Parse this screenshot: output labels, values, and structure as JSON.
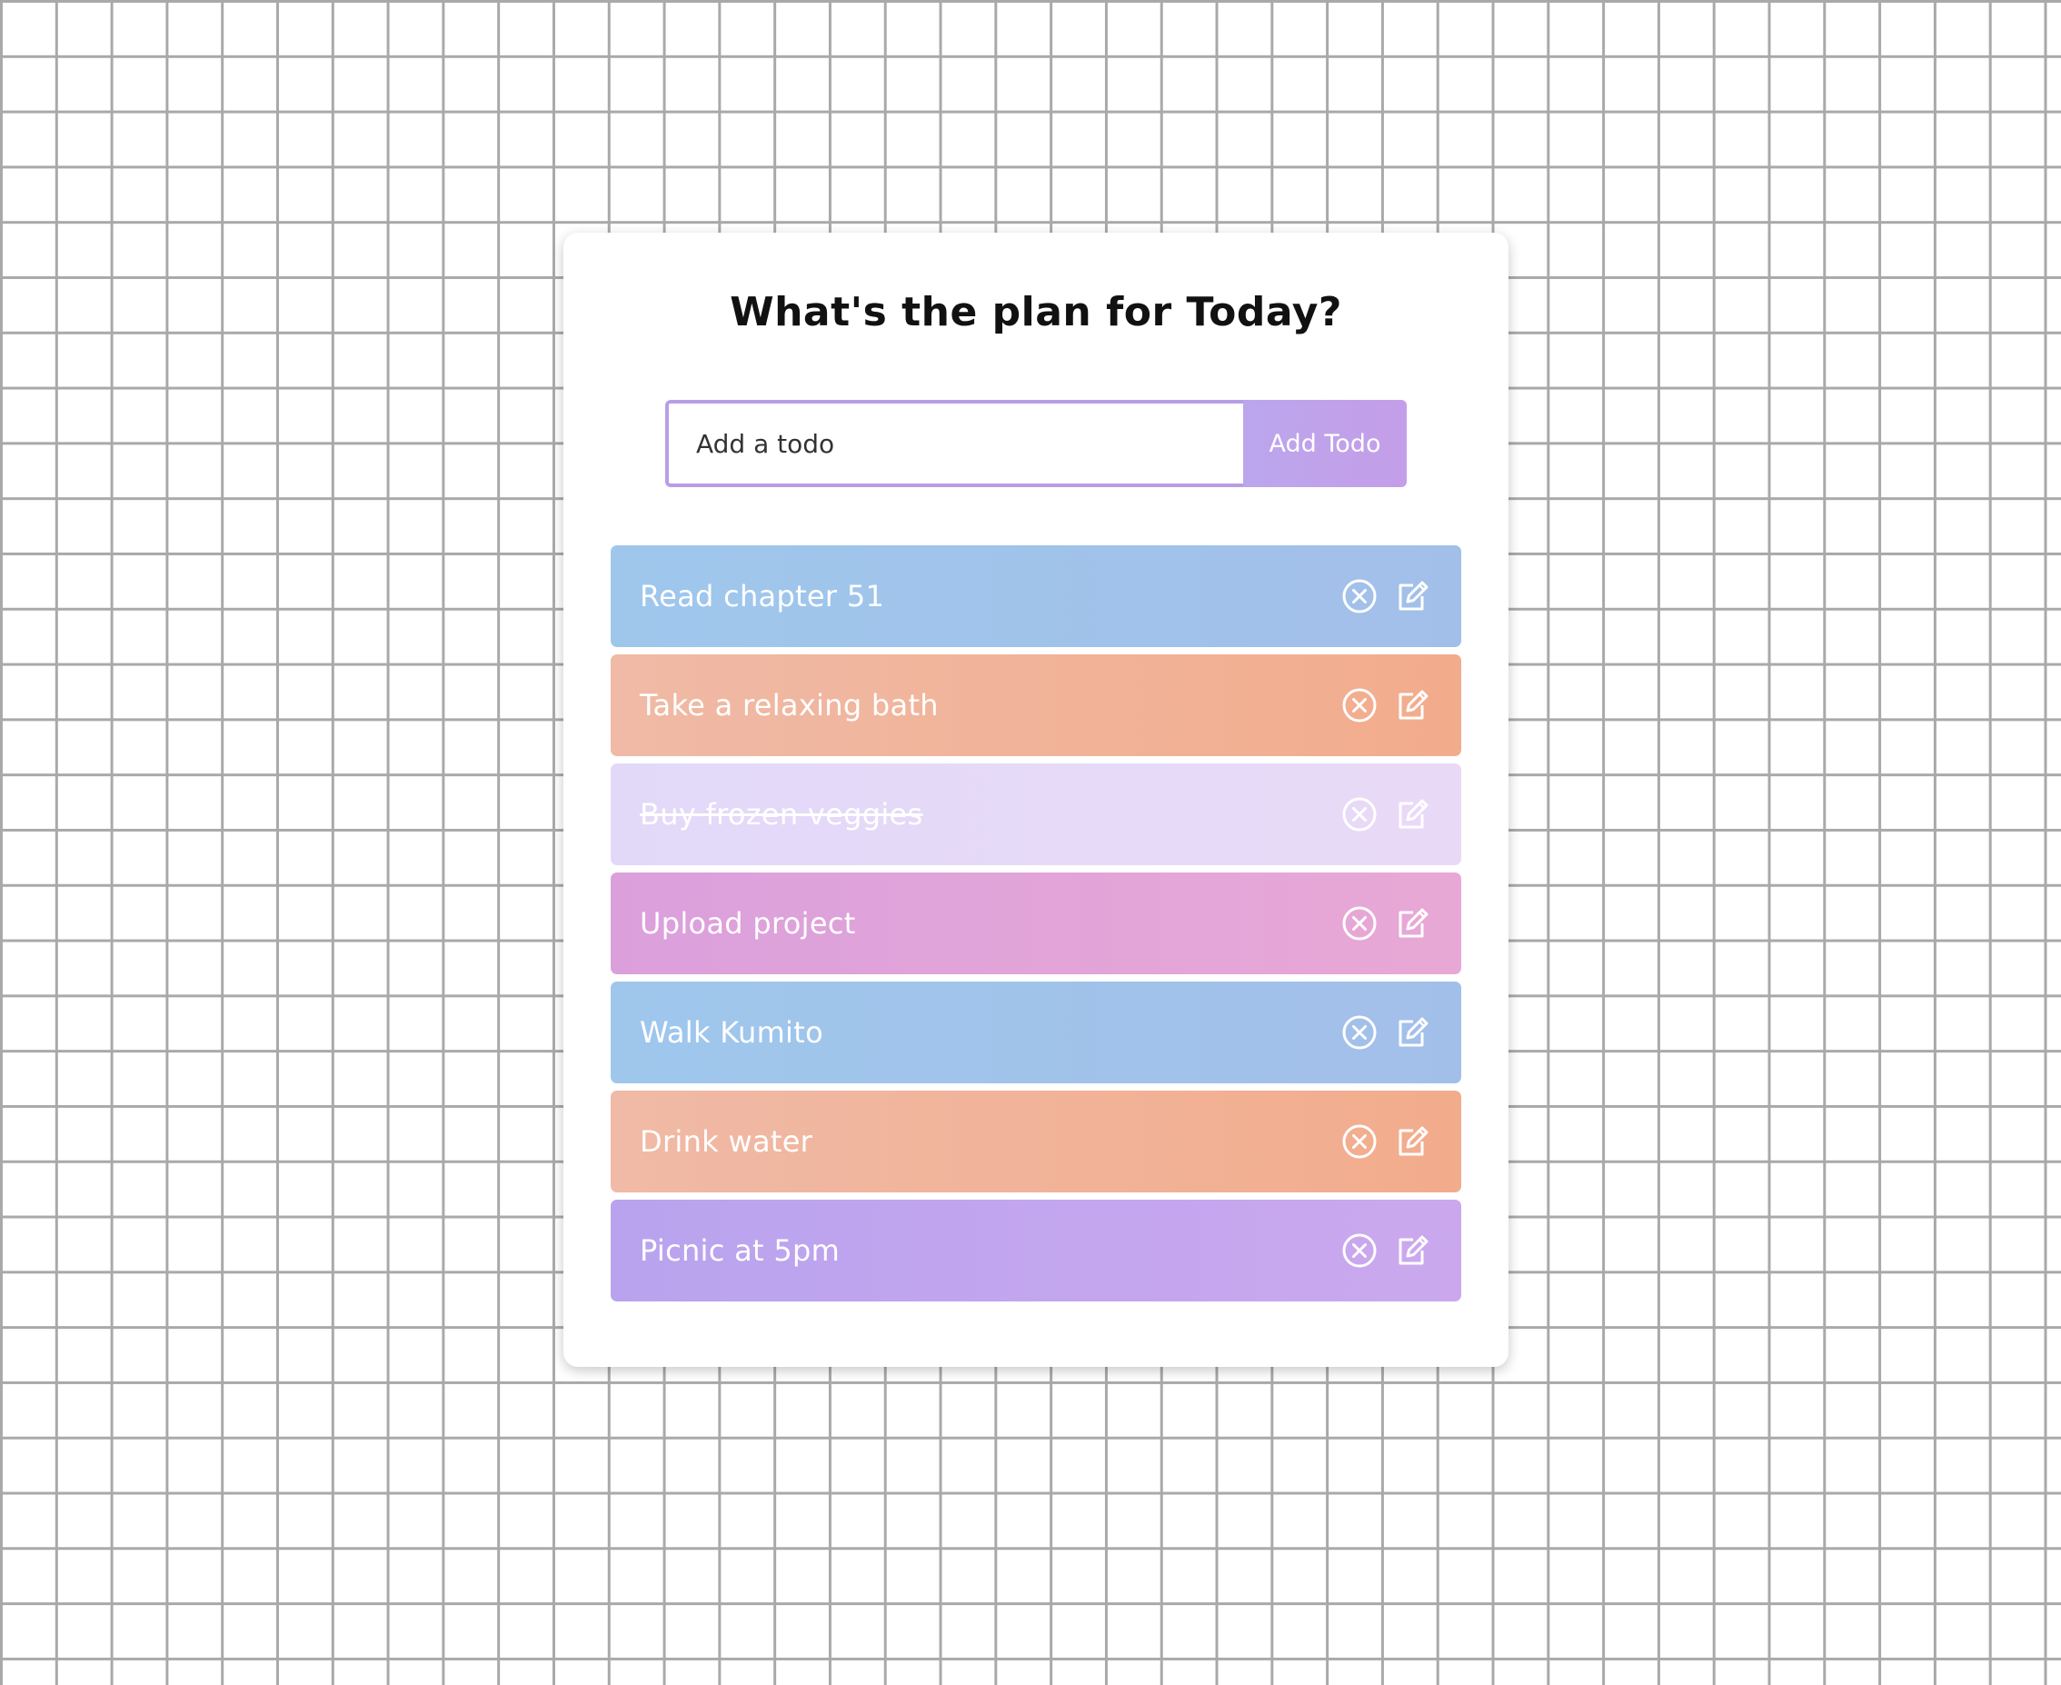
{
  "app": {
    "title": "What's the plan for Today?"
  },
  "form": {
    "input_placeholder": "Add a todo",
    "input_value": "",
    "add_button_label": "Add Todo"
  },
  "todos": [
    {
      "text": "Read chapter 51",
      "complete": false,
      "color": "#9fc7ec"
    },
    {
      "text": "Take a relaxing bath",
      "complete": false,
      "color": "#f1b49a"
    },
    {
      "text": "Buy frozen veggies",
      "complete": true,
      "color": "#c9b2f0"
    },
    {
      "text": "Upload project",
      "complete": false,
      "color": "#e0a6dc"
    },
    {
      "text": "Walk Kumito",
      "complete": false,
      "color": "#9fc7ec"
    },
    {
      "text": "Drink water",
      "complete": false,
      "color": "#f1b49a"
    },
    {
      "text": "Picnic at 5pm",
      "complete": false,
      "color": "#c0a6ee"
    }
  ],
  "icons": {
    "delete": "close-circle-icon",
    "edit": "edit-icon"
  },
  "colors": {
    "accent": "#b89ee6",
    "grid_line": "#a9a9a9",
    "card_background": "#ffffff"
  }
}
